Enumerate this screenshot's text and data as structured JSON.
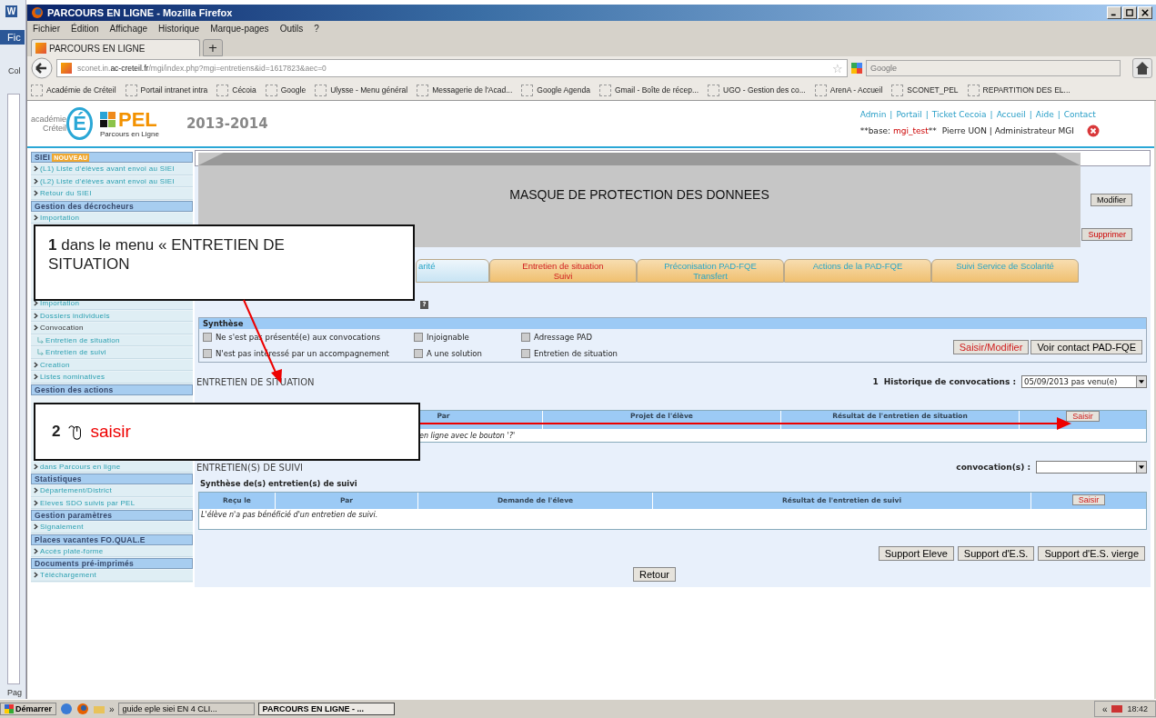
{
  "word": {
    "icon": "W",
    "tab": "Fic",
    "group": "Col",
    "status": "Pag"
  },
  "window": {
    "title": "PARCOURS EN LIGNE - Mozilla Firefox"
  },
  "menu": [
    "Fichier",
    "Édition",
    "Affichage",
    "Historique",
    "Marque-pages",
    "Outils",
    "?"
  ],
  "tabs": [
    {
      "label": "PARCOURS EN LIGNE",
      "selected": true
    }
  ],
  "new_tab": "+",
  "url": "sconet.in.**ac-creteil.fr**/mgi/index.php?mgi=entretiens&id=1617823&aec=0",
  "bookmark_star": "☆",
  "search": {
    "placeholder": "Google"
  },
  "bookmarks": [
    "Académie de Créteil",
    "Portail intranet intra",
    "Cécoia",
    "Google",
    "Ulysse - Menu général",
    "Messagerie de l'Acad...",
    "Google Agenda",
    "Gmail - Boîte de récep...",
    "UGO - Gestion des co...",
    "ArenA - Accueil",
    "SCONET_PEL",
    "REPARTITION DES EL..."
  ],
  "header": {
    "academy_line1": "académie",
    "academy_line2": "Créteil",
    "academy_letter": "É",
    "app_logo": "PEL",
    "app_name": "Parcours en Ligne",
    "year": "2013-2014",
    "links": [
      "Admin",
      "Portail",
      "Ticket Cecoia",
      "Accueil",
      "Aide",
      "Contact"
    ],
    "separator": "|",
    "base_prefix": "**base: ",
    "base_name": "mgi_test",
    "base_suffix": "**",
    "user": "Pierre UON | Administrateur MGI"
  },
  "sidebar": [
    [
      {
        "kind": "header",
        "label": "SIEI",
        "badge": "NOUVEAU"
      },
      {
        "kind": "link",
        "label": "(L1) Liste d'élèves avant envoi au SIEI"
      },
      {
        "kind": "link",
        "label": "(L2) Liste d'élèves avant envoi au SIEI"
      },
      {
        "kind": "link",
        "label": "Retour du SIEI"
      },
      {
        "kind": "header",
        "label": "Gestion des décrocheurs"
      },
      {
        "kind": "link",
        "label": "Importation"
      }
    ],
    [
      {
        "kind": "link",
        "label": "Importation"
      },
      {
        "kind": "link",
        "label": "Dossiers individuels"
      },
      {
        "kind": "plain",
        "label": "Convocation"
      },
      {
        "kind": "sub",
        "label": "Entretien de situation"
      },
      {
        "kind": "sub",
        "label": "Entretien de suivi"
      },
      {
        "kind": "link",
        "label": "Creation"
      },
      {
        "kind": "link",
        "label": "Listes nominatives"
      },
      {
        "kind": "header",
        "label": "Gestion des actions"
      }
    ],
    [
      {
        "kind": "link",
        "label": "dans Parcours en ligne"
      },
      {
        "kind": "header",
        "label": "Statistiques"
      },
      {
        "kind": "link",
        "label": "Département/District"
      },
      {
        "kind": "link",
        "label": "Eleves SDO suivis par PEL"
      },
      {
        "kind": "header",
        "label": "Gestion paramètres"
      },
      {
        "kind": "link",
        "label": "Signalement"
      },
      {
        "kind": "header",
        "label": "Places vacantes FO.QUAL.E"
      },
      {
        "kind": "link",
        "label": "Accès plate-forme"
      },
      {
        "kind": "header",
        "label": "Documents pré-imprimés"
      },
      {
        "kind": "link",
        "label": "Téléchargement"
      }
    ]
  ],
  "mask": {
    "title": "MASQUE DE PROTECTION DES DONNEES"
  },
  "record_buttons": [
    {
      "label": "Modifier",
      "kind": "normal"
    },
    {
      "label": "Supprimer",
      "kind": "danger"
    }
  ],
  "page_tabs": [
    {
      "lines": [
        "arité"
      ],
      "selected": false
    },
    {
      "lines": [
        "Entretien de situation",
        "Suivi"
      ],
      "selected": true
    },
    {
      "lines": [
        "Préconisation PAD-FQE",
        "Transfert"
      ],
      "selected": false
    },
    {
      "lines": [
        "Actions de la PAD-FQE"
      ],
      "selected": false
    },
    {
      "lines": [
        "Suivi Service de Scolarité"
      ],
      "selected": false
    }
  ],
  "help_icon": "?",
  "synthese": {
    "title": "Synthèse",
    "checkboxes": [
      {
        "label": "Ne s'est pas présenté(e) aux convocations",
        "checked": false
      },
      {
        "label": "Injoignable",
        "checked": false
      },
      {
        "label": "Adressage PAD",
        "checked": false
      },
      {
        "label": "N'est pas intéressé par un accompagnement",
        "checked": false
      },
      {
        "label": "A une solution",
        "checked": false
      },
      {
        "label": "Entretien de situation",
        "checked": false
      }
    ],
    "buttons": [
      {
        "label": "Saisir/Modifier",
        "kind": "danger"
      },
      {
        "label": "Voir contact PAD-FQE",
        "kind": "normal"
      }
    ]
  },
  "situation": {
    "title": "ENTRETIEN DE SITUATION",
    "count": "1",
    "history_label": "Historique de convocations :",
    "history_value": "05/09/2013 pas venu(e)",
    "table": {
      "columns": [
        "",
        "Par",
        "Projet de l'élève",
        "Résultat de l'entretien de situation"
      ],
      "action": "Saisir",
      "row": "en ligne avec le bouton '?'"
    }
  },
  "suivi": {
    "title": "ENTRETIEN(S) DE SUIVI",
    "convocations_label": "convocation(s) :",
    "subtitle": "Synthèse de(s) entretien(s) de suivi",
    "table": {
      "columns": [
        "Reçu le",
        "Par",
        "Demande de l'éleve",
        "Résultat de l'entretien de suivi"
      ],
      "action": "Saisir",
      "row": "L'élève n'a pas bénéficié d'un entretien de suivi."
    }
  },
  "support_buttons": [
    "Support Eleve",
    "Support d'E.S.",
    "Support d'E.S. vierge"
  ],
  "back_button": "Retour",
  "callout_1": {
    "text": "**1** dans le menu « ENTRETIEN DE SITUATION"
  },
  "callout_2": {
    "number": "2",
    "action": "saisir"
  },
  "taskbar": {
    "start": "Démarrer",
    "chevron": "»",
    "tasks": [
      {
        "label": "guide eple siei  EN 4 CLI...",
        "selected": false
      },
      {
        "label": "PARCOURS EN LIGNE - ...",
        "selected": true
      }
    ],
    "tray_chevron": "«",
    "time": "18:42"
  }
}
